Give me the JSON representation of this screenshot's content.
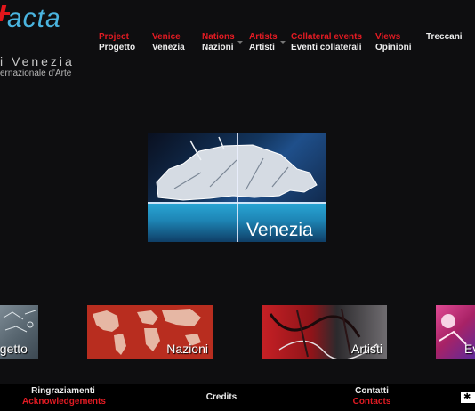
{
  "logo": {
    "wordmark": "acta",
    "line1": "i Venezia",
    "line2": "ernazionale d'Arte"
  },
  "nav": [
    {
      "en": "Project",
      "it": "Progetto"
    },
    {
      "en": "Venice",
      "it": "Venezia"
    },
    {
      "en": "Nations",
      "it": "Nazioni"
    },
    {
      "en": "Artists",
      "it": "Artisti"
    },
    {
      "en": "Collateral events",
      "it": "Eventi collaterali"
    },
    {
      "en": "Views",
      "it": "Opinioni"
    },
    {
      "label": "Treccani"
    }
  ],
  "hero": {
    "label": "Venezia"
  },
  "thumbs": [
    {
      "label": "ogetto"
    },
    {
      "label": "Nazioni"
    },
    {
      "label": "Artisti"
    },
    {
      "label": "Ev"
    }
  ],
  "footer": {
    "acknowledgements": {
      "it": "Ringraziamenti",
      "en": "Acknowledgements"
    },
    "credits": "Credits",
    "contacts": {
      "it": "Contatti",
      "en": "Contacts"
    },
    "badge": "✱"
  },
  "colors": {
    "background": "#0e0e10",
    "accent_red": "#e21b23",
    "logo_blue": "#4ab4df"
  }
}
